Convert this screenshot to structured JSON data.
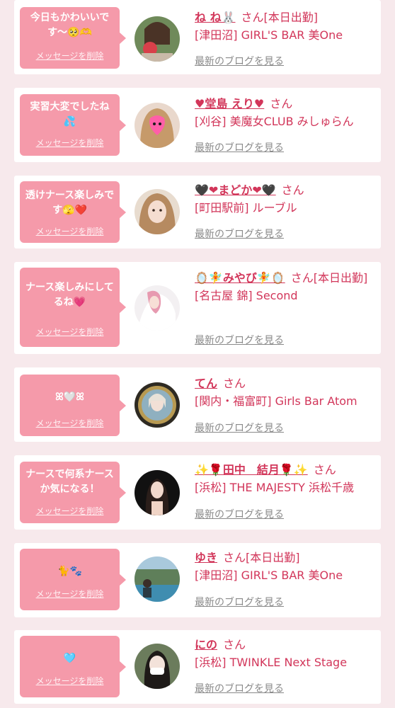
{
  "colors": {
    "background": "#f7e9ec",
    "bubble": "#f59aaa",
    "accent": "#d2365a",
    "link_gray": "#8a8a8a"
  },
  "common": {
    "delete_label": "メッセージを削除",
    "blog_label": "最新のブログを見る",
    "honorific": "さん"
  },
  "cards": [
    {
      "message": "今日もかわいいです〜🥺🫶",
      "name": "ね ね🐰",
      "status": "[本日出勤]",
      "shop": "[津田沼] GIRL'S BAR 美One"
    },
    {
      "message": "実習大変でしたね💦",
      "name": "♥堂島 えり♥",
      "status": "",
      "shop": "[刈谷] 美魔女CLUB みしゅらん"
    },
    {
      "message": "透けナース楽しみです🫣❤️",
      "name": "🖤❤まどか❤🖤",
      "status": "",
      "shop": "[町田駅前] ルーブル"
    },
    {
      "message": "ナース楽しみにしてるね💗",
      "name": "🪞🧚みやび🧚🪞",
      "status": "[本日出勤]",
      "shop": "[名古屋 錦] Second"
    },
    {
      "message": "ꕤ🤍ꕤ",
      "name": "てん",
      "status": "",
      "shop": "[関内・福富町] Girls Bar Atom"
    },
    {
      "message": "ナースで何系ナースか気になる！",
      "name": "✨🌹田中　結月🌹✨",
      "status": "",
      "shop": "[浜松] THE MAJESTY 浜松千歳"
    },
    {
      "message": "🐈🐾",
      "name": "ゆき",
      "status": "[本日出勤]",
      "shop": "[津田沼] GIRL'S BAR 美One"
    },
    {
      "message": "🩵",
      "name": "にの",
      "status": "",
      "shop": "[浜松] TWINKLE Next Stage"
    }
  ]
}
